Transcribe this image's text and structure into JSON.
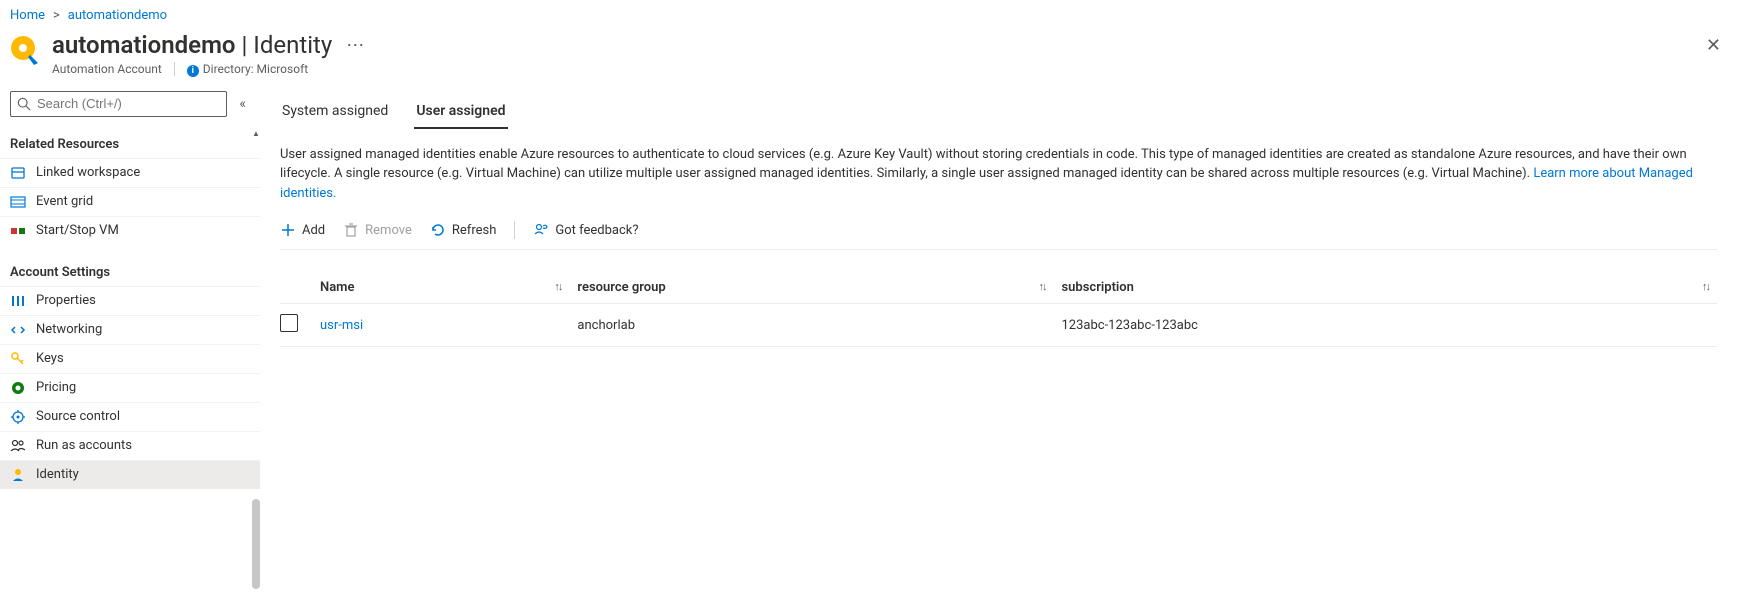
{
  "breadcrumb": {
    "home": "Home",
    "current": "automationdemo"
  },
  "header": {
    "name": "automationdemo",
    "suffix": "Identity",
    "subtitle": "Automation Account",
    "directory_label": "Directory: Microsoft"
  },
  "search": {
    "placeholder": "Search (Ctrl+/)"
  },
  "sections": {
    "related": {
      "title": "Related Resources",
      "items": {
        "linked_workspace": "Linked workspace",
        "event_grid": "Event grid",
        "start_stop_vm": "Start/Stop VM"
      }
    },
    "account": {
      "title": "Account Settings",
      "items": {
        "properties": "Properties",
        "networking": "Networking",
        "keys": "Keys",
        "pricing": "Pricing",
        "source_control": "Source control",
        "run_as_accounts": "Run as accounts",
        "identity": "Identity"
      }
    }
  },
  "tabs": {
    "system": "System assigned",
    "user": "User assigned"
  },
  "description": {
    "body": "User assigned managed identities enable Azure resources to authenticate to cloud services (e.g. Azure Key Vault) without storing credentials in code. This type of managed identities are created as standalone Azure resources, and have their own lifecycle. A single resource (e.g. Virtual Machine) can utilize multiple user assigned managed identities. Similarly, a single user assigned managed identity can be shared across multiple resources (e.g. Virtual Machine). ",
    "link": "Learn more about Managed identities."
  },
  "toolbar": {
    "add": "Add",
    "remove": "Remove",
    "refresh": "Refresh",
    "feedback": "Got feedback?"
  },
  "table": {
    "headers": {
      "name": "Name",
      "resource_group": "resource group",
      "subscription": "subscription"
    },
    "rows": [
      {
        "name": "usr-msi",
        "resource_group": "anchorlab",
        "subscription": "123abc-123abc-123abc"
      }
    ]
  }
}
